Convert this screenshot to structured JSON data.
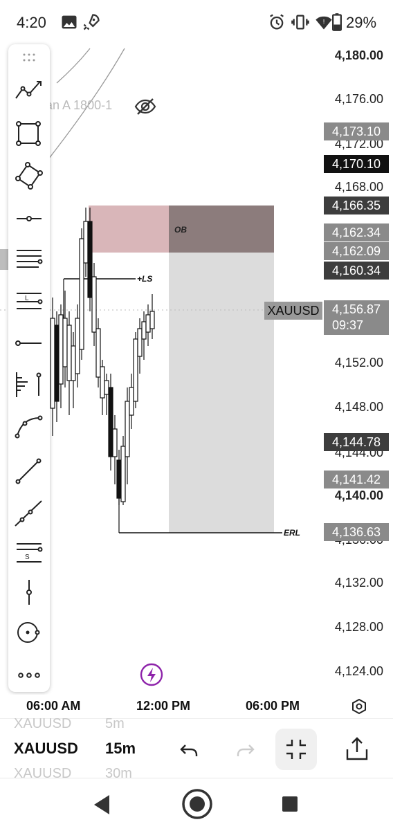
{
  "status": {
    "time": "4:20",
    "battery": "29%",
    "icons": [
      "image-icon",
      "rocket-icon",
      "alarm-icon",
      "vibrate-icon",
      "wifi-icon",
      "battery-icon"
    ]
  },
  "chart": {
    "series_label": "an A 1800-1",
    "symbol_label": "XAUUSD",
    "countdown": "09:37",
    "annotations": {
      "ob": "OB",
      "ls": "+LS",
      "erl": "ERL"
    },
    "price_labels": [
      "4,180.00",
      "4,176.00",
      "4,172.00",
      "4,168.00",
      "4,152.00",
      "4,148.00",
      "4,144.00",
      "4,140.00",
      "4,136.00",
      "4,132.00",
      "4,128.00",
      "4,124.00"
    ],
    "price_tags": [
      {
        "value": "4,173.10",
        "color": "#8a8a8a"
      },
      {
        "value": "4,170.10",
        "color": "#111111"
      },
      {
        "value": "4,166.35",
        "color": "#3d3d3d"
      },
      {
        "value": "4,162.34",
        "color": "#8a8a8a"
      },
      {
        "value": "4,162.09",
        "color": "#8a8a8a"
      },
      {
        "value": "4,160.34",
        "color": "#3d3d3d"
      },
      {
        "value": "4,156.87",
        "color": "#8a8a8a"
      },
      {
        "value": "4,144.78",
        "color": "#3d3d3d"
      },
      {
        "value": "4,141.42",
        "color": "#8a8a8a"
      },
      {
        "value": "4,136.63",
        "color": "#8a8a8a"
      }
    ],
    "x_labels": [
      "06:00 AM",
      "12:00 PM",
      "06:00 PM"
    ],
    "colors": {
      "ob_zone": "#d9b6b9",
      "ob_overlap": "#8c7c7c",
      "range_zone": "#dcdcdc",
      "accent": "#8e24aa"
    }
  },
  "toolbar": {
    "tools": [
      "trend-line-icon",
      "rectangle-icon",
      "rotated-rectangle-icon",
      "horizontal-ray-icon",
      "fib-retracement-icon",
      "long-position-icon",
      "horizontal-line-icon",
      "volume-profile-icon",
      "curve-icon",
      "line-segment-icon",
      "extended-line-icon",
      "short-position-icon",
      "vertical-line-icon",
      "circle-icon",
      "more-icon"
    ]
  },
  "bottom": {
    "symbol_above": "XAUUSD",
    "interval_above": "5m",
    "symbol": "XAUUSD",
    "interval": "15m",
    "symbol_below": "XAUUSD",
    "interval_below": "30m"
  }
}
